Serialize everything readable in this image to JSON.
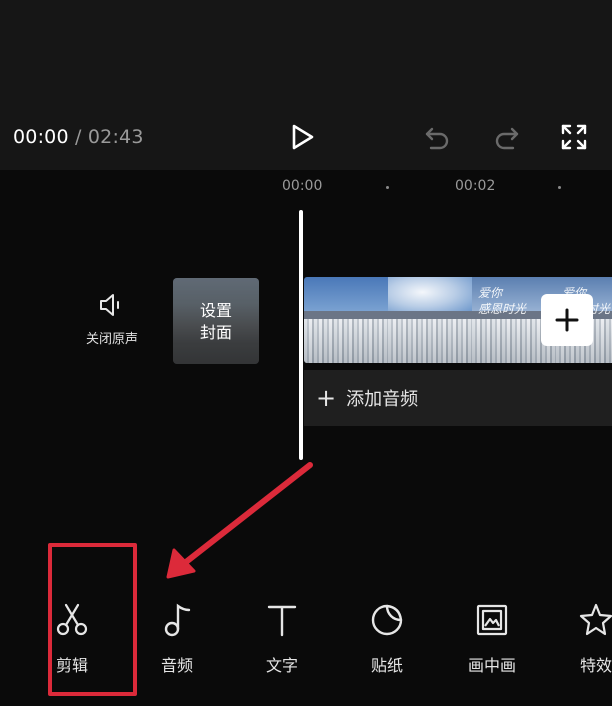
{
  "player": {
    "current_time": "00:00",
    "separator": "/",
    "total_time": "02:43"
  },
  "controls": {
    "play_icon": "play-icon",
    "undo_icon": "undo-icon",
    "redo_icon": "redo-icon",
    "fullscreen_icon": "fullscreen-icon"
  },
  "timeline": {
    "ruler": [
      "00:00",
      "00:02"
    ],
    "mute_label": "关闭原声",
    "cover_label_line1": "设置",
    "cover_label_line2": "封面",
    "clip_frames": [
      {
        "overlay_text": ""
      },
      {
        "overlay_text": ""
      },
      {
        "overlay_text": "爱你\n感恩时光"
      },
      {
        "overlay_text": "爱你\n感恩时光"
      }
    ],
    "add_audio_plus": "+",
    "add_audio_label": "添加音频"
  },
  "toolbar": {
    "items": [
      {
        "label": "剪辑",
        "icon": "scissors-icon"
      },
      {
        "label": "音频",
        "icon": "music-note-icon"
      },
      {
        "label": "文字",
        "icon": "text-icon"
      },
      {
        "label": "贴纸",
        "icon": "sticker-icon"
      },
      {
        "label": "画中画",
        "icon": "picture-in-picture-icon"
      },
      {
        "label": "特效",
        "icon": "effects-star-icon"
      }
    ]
  },
  "annotation": {
    "highlight_color": "#dc2a3a",
    "arrow_color": "#dc2a3a"
  }
}
